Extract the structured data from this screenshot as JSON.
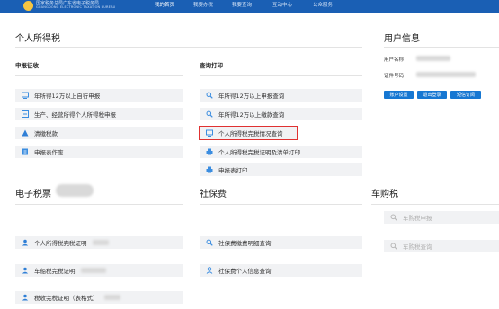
{
  "header": {
    "logo_cn": "国家税务总局广东省电子税务局",
    "logo_en": "GUANGDONG ELECTRONIC TAXATION BUREAU",
    "nav": [
      "我的首页",
      "我要办税",
      "我要查询",
      "互动中心",
      "公众服务"
    ]
  },
  "personal_tax": {
    "title": "个人所得税",
    "declare": {
      "title": "申报征收",
      "items": [
        {
          "label": "年所得12万以上自行申报",
          "icon": "screen-icon"
        },
        {
          "label": "生产、经营所得个人所得税申报",
          "icon": "form-icon"
        },
        {
          "label": "清缴税款",
          "icon": "person-icon"
        },
        {
          "label": "申报表作废",
          "icon": "document-icon"
        }
      ]
    },
    "query": {
      "title": "查询打印",
      "items": [
        {
          "label": "年所得12万以上申报查询",
          "icon": "search-icon"
        },
        {
          "label": "年所得12万以上缴款查询",
          "icon": "search-icon"
        },
        {
          "label": "个人所得税完税情况查询",
          "icon": "screen-icon"
        },
        {
          "label": "个人所得税完税证明及清单打印",
          "icon": "printer-icon"
        },
        {
          "label": "申报表打印",
          "icon": "printer-icon"
        }
      ]
    }
  },
  "user_info": {
    "title": "用户信息",
    "name_label": "用户名称：",
    "id_label": "证件号码：",
    "buttons": [
      "账户设置",
      "退出登录",
      "短信订阅"
    ]
  },
  "e_ticket": {
    "title": "电子税票",
    "items": [
      {
        "label": "个人所得税完税证明",
        "icon": "person-icon"
      },
      {
        "label": "车船税完税证明",
        "icon": "person-icon"
      },
      {
        "label": "税收完税证明（表格式）",
        "icon": "person-icon"
      }
    ]
  },
  "social": {
    "title": "社保费",
    "items": [
      {
        "label": "社保费缴费明细查询",
        "icon": "search-icon"
      },
      {
        "label": "社保费个人信息查询",
        "icon": "person-outline-icon"
      }
    ]
  },
  "vehicle": {
    "title": "车购税",
    "items": [
      {
        "label": "车购税申报",
        "icon": "search-icon"
      },
      {
        "label": "车购税查询",
        "icon": "search-icon"
      }
    ]
  },
  "colors": {
    "brand": "#1a5fb4",
    "accent": "#1677d2",
    "highlight": "#e03131",
    "tile": "#f1f2f4"
  }
}
